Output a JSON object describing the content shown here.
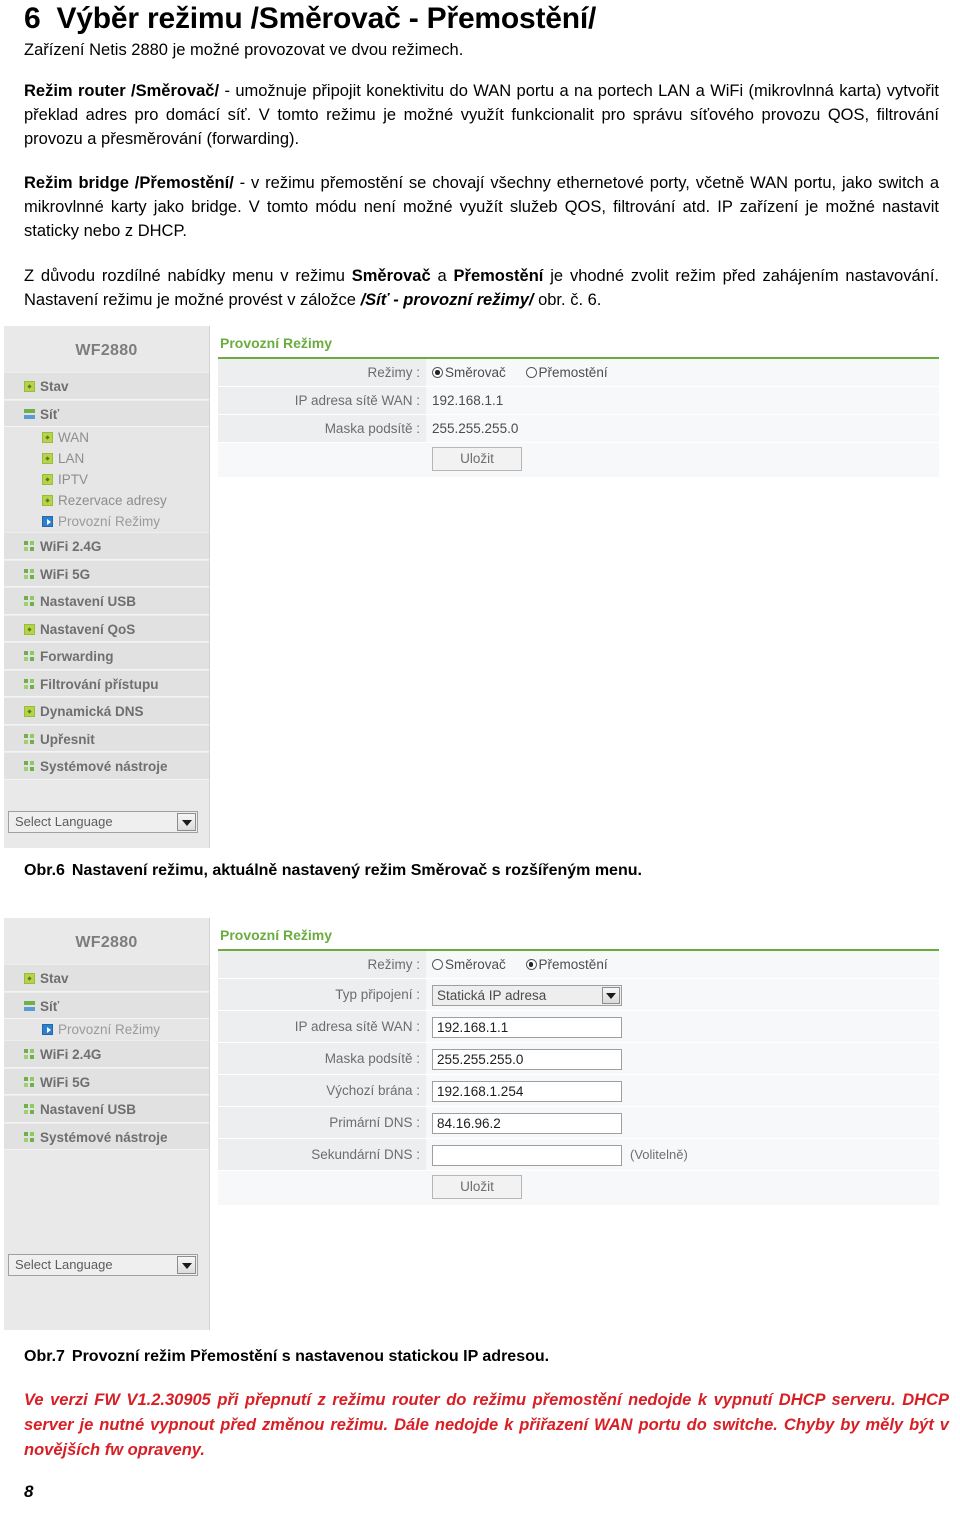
{
  "document": {
    "section_number": "6",
    "heading": "Výběr režimu /Směrovač - Přemostění/",
    "lead": "Zařízení Netis 2880 je možné provozovat ve dvou režimech.",
    "paragraph1": {
      "bold": "Režim router /Směrovač/",
      "rest": " - umožnuje připojit konektivitu do WAN portu a na portech LAN a WiFi (mikrovlnná karta) vytvořit překlad adres pro domácí síť. V tomto režimu je možné využít funkcionalit pro správu síťového provozu QOS, filtrování provozu a přesměrování (forwarding)."
    },
    "paragraph2": {
      "bold": "Režim bridge /Přemostění/",
      "rest": " - v režimu přemostění se chovají všechny ethernetové porty, včetně WAN portu, jako switch a mikrovlnné karty jako bridge. V tomto módu není možné využít služeb QOS, filtrování atd. IP zařízení je možné nastavit staticky nebo z DHCP."
    },
    "paragraph3": {
      "part1": "Z důvodu rozdílné nabídky menu v režimu ",
      "bold1": "Směrovač",
      "part2": " a ",
      "bold2": "Přemostění",
      "part3": " je vhodné zvolit režim před zahájením nastavování. Nastavení režimu je možné provést v záložce ",
      "italic": "/Síť - provozní režimy/",
      "part4": " obr. č. 6."
    },
    "figure6_caption_label": "Obr.6",
    "figure6_caption_text": "Nastavení režimu, aktuálně nastavený režim Směrovač s rozšířeným menu.",
    "figure7_caption_label": "Obr.7",
    "figure7_caption_text": "Provozní režim Přemostění s nastavenou statickou IP adresou.",
    "warning": "Ve verzi FW V1.2.30905 při přepnutí z režimu router do režimu přemostění nedojde k vypnutí DHCP serveru. DHCP server je nutné vypnout před změnou režimu. Dále nedojde k přiřazení WAN portu do switche. Chyby by měly být v novějších fw opraveny.",
    "page_number": "8",
    "colors": {
      "warning_red": "#d81f26",
      "accent_green": "#6cab3e",
      "sidebar_bg": "#e1e1e1",
      "label_bg": "#eceef0"
    }
  },
  "figure6": {
    "sidebar": {
      "brand": "WF2880",
      "language_select": {
        "value": "Select Language",
        "icon": "chevron-down-icon"
      },
      "items": [
        {
          "label": "Stav",
          "icon": "green-square-icon",
          "level": 0
        },
        {
          "label": "Síť",
          "icon": "network-bars-icon",
          "level": 0
        },
        {
          "label": "WAN",
          "icon": "green-square-icon",
          "level": 1
        },
        {
          "label": "LAN",
          "icon": "green-square-icon",
          "level": 1
        },
        {
          "label": "IPTV",
          "icon": "green-square-icon",
          "level": 1
        },
        {
          "label": "Rezervace adresy",
          "icon": "green-square-icon",
          "level": 1
        },
        {
          "label": "Provozní Režimy",
          "icon": "blue-play-icon",
          "level": 1,
          "active": true
        },
        {
          "label": "WiFi 2.4G",
          "icon": "grid-squares-icon",
          "level": 0
        },
        {
          "label": "WiFi 5G",
          "icon": "grid-squares-icon",
          "level": 0
        },
        {
          "label": "Nastavení USB",
          "icon": "grid-squares-icon",
          "level": 0
        },
        {
          "label": "Nastavení QoS",
          "icon": "green-square-icon",
          "level": 0
        },
        {
          "label": "Forwarding",
          "icon": "grid-squares-icon",
          "level": 0
        },
        {
          "label": "Filtrování přístupu",
          "icon": "grid-squares-icon",
          "level": 0
        },
        {
          "label": "Dynamická DNS",
          "icon": "green-square-icon",
          "level": 0
        },
        {
          "label": "Upřesnit",
          "icon": "grid-squares-icon",
          "level": 0
        },
        {
          "label": "Systémové nástroje",
          "icon": "grid-squares-icon",
          "level": 0
        }
      ]
    },
    "content": {
      "title": "Provozní Režimy",
      "rows": [
        {
          "label": "Režimy :",
          "type": "radio",
          "options": [
            {
              "label": "Směrovač",
              "selected": true
            },
            {
              "label": "Přemostění",
              "selected": false
            }
          ]
        },
        {
          "label": "IP adresa sítě WAN :",
          "type": "text",
          "value": "192.168.1.1"
        },
        {
          "label": "Maska podsítě :",
          "type": "text",
          "value": "255.255.255.0"
        }
      ],
      "save_label": "Uložit"
    }
  },
  "figure7": {
    "sidebar": {
      "brand": "WF2880",
      "language_select": {
        "value": "Select Language",
        "icon": "chevron-down-icon"
      },
      "items": [
        {
          "label": "Stav",
          "icon": "green-square-icon",
          "level": 0
        },
        {
          "label": "Síť",
          "icon": "network-bars-icon",
          "level": 0
        },
        {
          "label": "Provozní Režimy",
          "icon": "blue-play-icon",
          "level": 1,
          "active": true
        },
        {
          "label": "WiFi 2.4G",
          "icon": "grid-squares-icon",
          "level": 0
        },
        {
          "label": "WiFi 5G",
          "icon": "grid-squares-icon",
          "level": 0
        },
        {
          "label": "Nastavení USB",
          "icon": "grid-squares-icon",
          "level": 0
        },
        {
          "label": "Systémové nástroje",
          "icon": "grid-squares-icon",
          "level": 0
        }
      ]
    },
    "content": {
      "title": "Provozní Režimy",
      "rows": [
        {
          "label": "Režimy :",
          "type": "radio",
          "options": [
            {
              "label": "Směrovač",
              "selected": false
            },
            {
              "label": "Přemostění",
              "selected": true
            }
          ]
        },
        {
          "label": "Typ připojení :",
          "type": "select",
          "value": "Statická IP adresa"
        },
        {
          "label": "IP adresa sítě WAN :",
          "type": "input",
          "value": "192.168.1.1"
        },
        {
          "label": "Maska podsítě :",
          "type": "input",
          "value": "255.255.255.0"
        },
        {
          "label": "Výchozí brána :",
          "type": "input",
          "value": "192.168.1.254"
        },
        {
          "label": "Primární DNS :",
          "type": "input",
          "value": "84.16.96.2"
        },
        {
          "label": "Sekundární DNS :",
          "type": "input",
          "value": "",
          "note": "(Volitelně)"
        }
      ],
      "save_label": "Uložit"
    }
  }
}
